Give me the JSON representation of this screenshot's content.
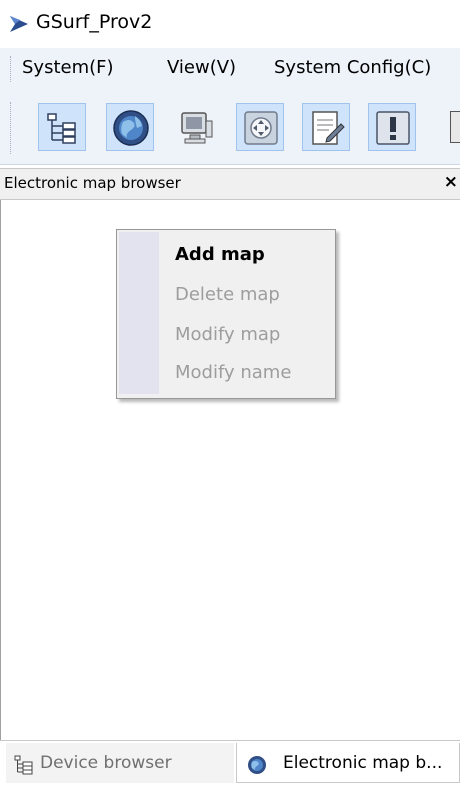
{
  "window": {
    "title": "GSurf_Prov2",
    "icon": "gsurf-app-icon"
  },
  "menubar": {
    "items": [
      "System(F)",
      "View(V)",
      "System Config(C)"
    ]
  },
  "toolbar": {
    "buttons": [
      {
        "icon": "device-tree-icon",
        "active": true
      },
      {
        "icon": "globe-icon",
        "active": true
      },
      {
        "icon": "video-monitor-icon",
        "active": false
      },
      {
        "icon": "ptz-control-icon",
        "active": true
      },
      {
        "icon": "edit-document-icon",
        "active": true
      },
      {
        "icon": "alarm-icon",
        "active": true
      }
    ]
  },
  "panel": {
    "title": "Electronic map browser",
    "close_label": "×"
  },
  "context_menu": {
    "items": [
      {
        "label": "Add map",
        "enabled": true
      },
      {
        "label": "Delete map",
        "enabled": false
      },
      {
        "label": "Modify map",
        "enabled": false
      },
      {
        "label": "Modify name",
        "enabled": false
      }
    ]
  },
  "bottom_tabs": [
    {
      "label": "Device browser",
      "icon": "device-tree-icon",
      "active": false
    },
    {
      "label": "Electronic map b...",
      "icon": "globe-icon",
      "active": true
    }
  ]
}
